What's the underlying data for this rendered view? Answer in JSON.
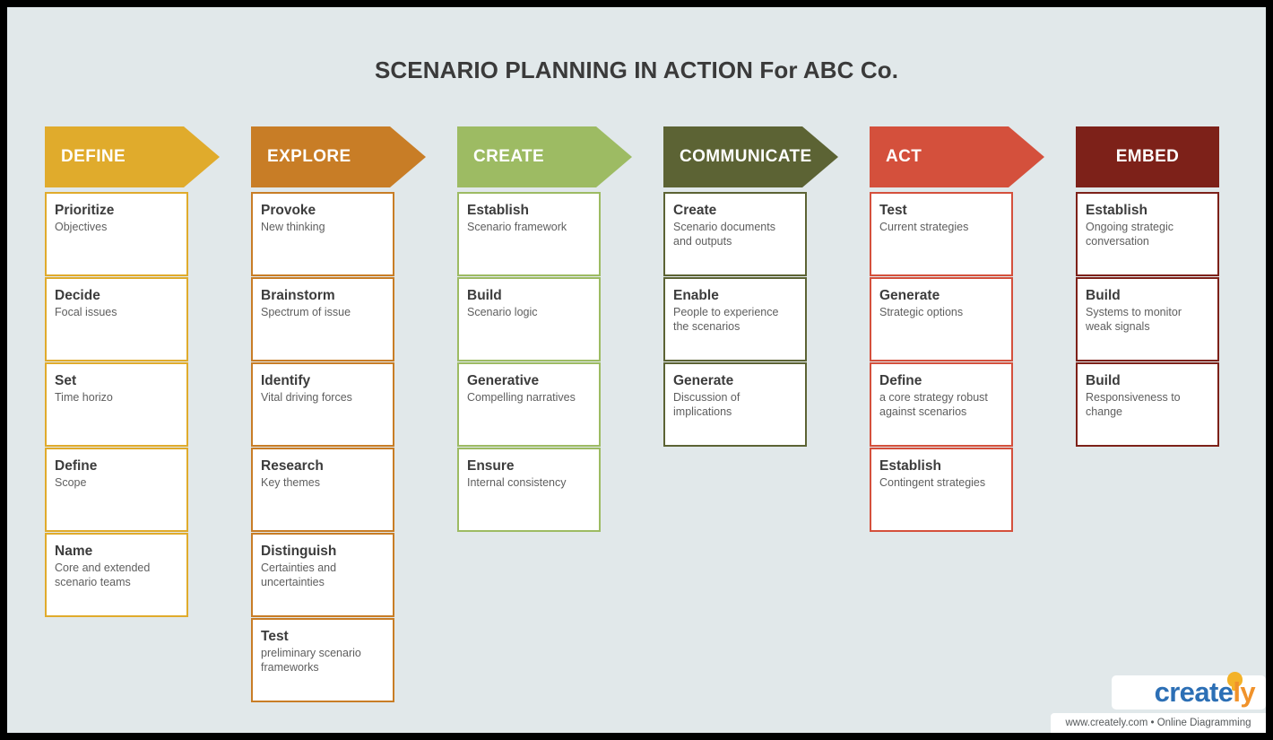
{
  "page": {
    "title": "SCENARIO PLANNING IN ACTION For ABC Co.",
    "background_color": "#E1E8EA",
    "frame_color": "#000000"
  },
  "columns": [
    {
      "header": "DEFINE",
      "color": "#E0AB2C",
      "shape": "arrow",
      "cards": [
        {
          "title": "Prioritize",
          "subtitle": "Objectives"
        },
        {
          "title": "Decide",
          "subtitle": "Focal issues"
        },
        {
          "title": "Set",
          "subtitle": "Time horizo"
        },
        {
          "title": "Define",
          "subtitle": "Scope"
        },
        {
          "title": "Name",
          "subtitle": "Core and extended scenario teams"
        }
      ]
    },
    {
      "header": "EXPLORE",
      "color": "#C87D26",
      "shape": "arrow",
      "cards": [
        {
          "title": "Provoke",
          "subtitle": "New thinking"
        },
        {
          "title": "Brainstorm",
          "subtitle": "Spectrum of issue"
        },
        {
          "title": "Identify",
          "subtitle": "Vital driving forces"
        },
        {
          "title": "Research",
          "subtitle": "Key themes"
        },
        {
          "title": "Distinguish",
          "subtitle": "Certainties and uncertainties"
        },
        {
          "title": "Test",
          "subtitle": "preliminary scenario frameworks"
        }
      ]
    },
    {
      "header": "CREATE",
      "color": "#9DBB63",
      "shape": "arrow",
      "cards": [
        {
          "title": "Establish",
          "subtitle": "Scenario framework"
        },
        {
          "title": "Build",
          "subtitle": "Scenario logic"
        },
        {
          "title": "Generative",
          "subtitle": "Compelling narratives"
        },
        {
          "title": "Ensure",
          "subtitle": "Internal consistency"
        }
      ]
    },
    {
      "header": "COMMUNICATE",
      "color": "#5C6334",
      "shape": "arrow",
      "cards": [
        {
          "title": "Create",
          "subtitle": "Scenario documents and outputs"
        },
        {
          "title": "Enable",
          "subtitle": "People to experience the scenarios"
        },
        {
          "title": "Generate",
          "subtitle": "Discussion of implications"
        }
      ]
    },
    {
      "header": "ACT",
      "color": "#D4503C",
      "shape": "arrow",
      "cards": [
        {
          "title": "Test",
          "subtitle": "Current strategies"
        },
        {
          "title": "Generate",
          "subtitle": "Strategic options"
        },
        {
          "title": "Define",
          "subtitle": "a core strategy robust against scenarios"
        },
        {
          "title": "Establish",
          "subtitle": "Contingent strategies"
        }
      ]
    },
    {
      "header": "EMBED",
      "color": "#7D2119",
      "shape": "rectangle",
      "cards": [
        {
          "title": "Establish",
          "subtitle": "Ongoing strategic conversation"
        },
        {
          "title": "Build",
          "subtitle": "Systems to monitor weak signals"
        },
        {
          "title": "Build",
          "subtitle": "Responsiveness to change"
        }
      ]
    }
  ],
  "brand": {
    "name_part1": "create",
    "name_part2": "ly",
    "tagline": "www.creately.com • Online Diagramming",
    "color_primary": "#2C6FB5",
    "color_accent": "#F0922B"
  }
}
